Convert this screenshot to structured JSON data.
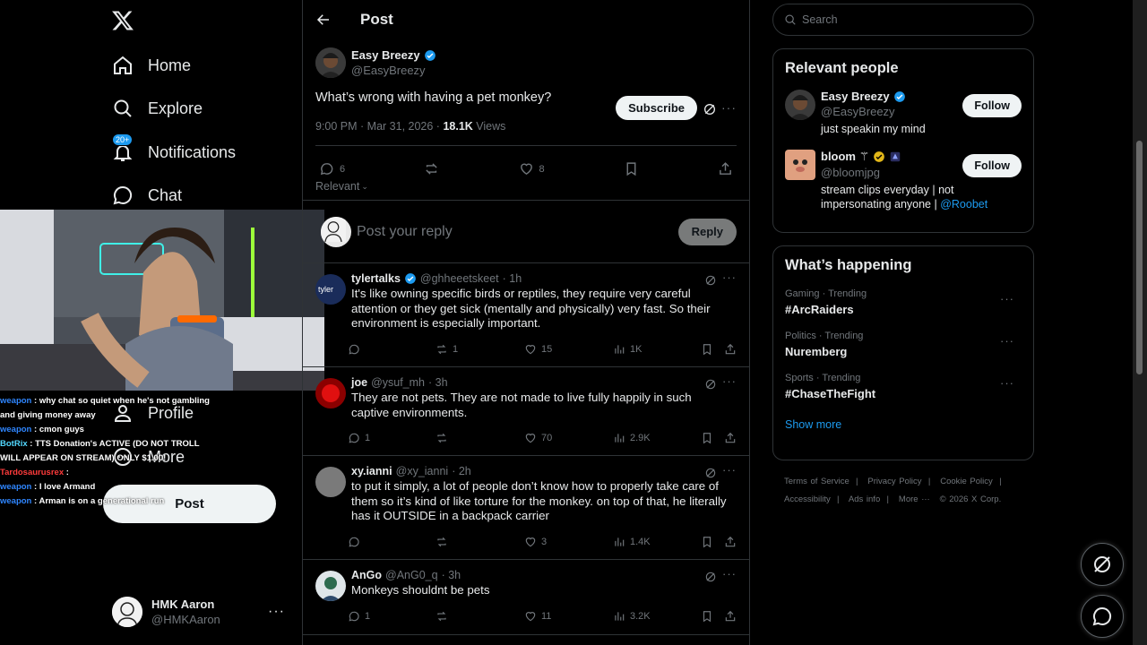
{
  "nav": {
    "items": [
      {
        "label": "Home"
      },
      {
        "label": "Explore"
      },
      {
        "label": "Notifications",
        "badge": "20+"
      },
      {
        "label": "Chat"
      },
      {
        "label": "Profile"
      },
      {
        "label": "More"
      }
    ],
    "post_label": "Post",
    "account": {
      "display_name": "HMK Aaron",
      "handle": "@HMKAaron"
    }
  },
  "stream_chat": [
    {
      "user": "weapon",
      "text": " : why chat so quiet when he's not gambling"
    },
    {
      "user": "",
      "text": "and giving money away"
    },
    {
      "user": "weapon",
      "text": " : cmon guys"
    },
    {
      "user": "BotRix",
      "text": " : TTS Donation's ACTIVE (DO NOT TROLL"
    },
    {
      "user": "",
      "text": "WILL APPEAR ON STREAM) ONLY $1.00!"
    },
    {
      "user": "Tardosaurusrex",
      "text": " : "
    },
    {
      "user": "weapon",
      "text": " : I love Armand"
    },
    {
      "user": "weapon",
      "text": " : Arman is on a generational run"
    }
  ],
  "header": {
    "title": "Post"
  },
  "post": {
    "author": "Easy Breezy",
    "handle": "@EasyBreezy",
    "subscribe_label": "Subscribe",
    "text": "What’s wrong with having a pet monkey?",
    "timestamp": "9:00 PM · Mar 31, 2026 · ",
    "views_count": "18.1K",
    "views_label": " Views",
    "replies": "6",
    "likes": "8",
    "sort_label": "Relevant"
  },
  "reply_box": {
    "placeholder": "Post your reply",
    "button": "Reply"
  },
  "replies": [
    {
      "name": "tylertalks",
      "verified": true,
      "handle": "@ghheeetskeet",
      "time": "· 1h",
      "text": "It's like owning specific birds or reptiles, they require very careful attention or they get sick (mentally and physically) very fast. So their environment is especially important.",
      "replies": "",
      "reposts": "1",
      "likes": "15",
      "views": "1K"
    },
    {
      "name": "joe",
      "verified": false,
      "handle": "@ysuf_mh",
      "time": "· 3h",
      "text": "They are not pets. They are not made to live fully happily in such captive environments.",
      "replies": "1",
      "reposts": "",
      "likes": "70",
      "views": "2.9K"
    },
    {
      "name": "xy.ianni",
      "verified": false,
      "handle": "@xy_ianni",
      "time": "· 2h",
      "text": "to put it simply, a lot of people don’t know how to properly take care of them so it’s kind of like torture for the monkey. on top of that, he literally has it OUTSIDE in a backpack carrier",
      "replies": "",
      "reposts": "",
      "likes": "3",
      "views": "1.4K"
    },
    {
      "name": "AnGo",
      "verified": false,
      "handle": "@AnG0_q",
      "time": "· 3h",
      "text": "Monkeys shouldnt be pets",
      "replies": "1",
      "reposts": "",
      "likes": "11",
      "views": "3.2K"
    }
  ],
  "search": {
    "placeholder": "Search"
  },
  "relevant_people": {
    "title": "Relevant people",
    "people": [
      {
        "name": "Easy Breezy",
        "handle": "@EasyBreezy",
        "bio": "just speakin my mind",
        "follow": "Follow"
      },
      {
        "name": "bloom ⚚",
        "handle": "@bloomjpg",
        "bio": "stream clips everyday | not impersonating anyone | ",
        "mention": "@Roobet",
        "follow": "Follow"
      }
    ]
  },
  "whats_happening": {
    "title": "What’s happening",
    "trends": [
      {
        "meta": "Gaming · Trending",
        "name": "#ArcRaiders"
      },
      {
        "meta": "Politics · Trending",
        "name": "Nuremberg"
      },
      {
        "meta": "Sports · Trending",
        "name": "#ChaseTheFight"
      }
    ],
    "show_more": "Show more"
  },
  "footer": {
    "links": [
      "Terms of Service",
      "|",
      "Privacy Policy",
      "|",
      "Cookie Policy",
      "|",
      "Accessibility",
      "|",
      "Ads info",
      "|",
      "More ···",
      "© 2026 X Corp."
    ]
  },
  "colors": {
    "accent": "#1d9bf0",
    "background": "#000000",
    "border": "#2f3336",
    "muted": "#71767b",
    "verified_gold": "#e2b719"
  }
}
